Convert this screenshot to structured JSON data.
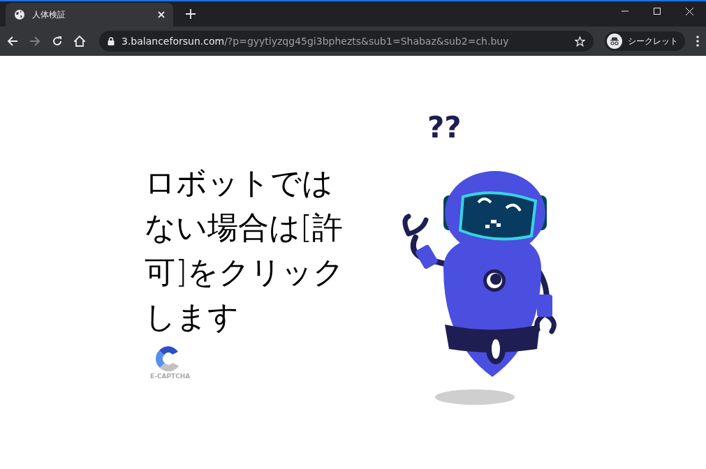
{
  "browser": {
    "tab": {
      "title": "人体検証",
      "selected": true
    },
    "address": {
      "host": "3.balanceforsun.com",
      "path": "/?p=gyytiyzqg45gi3bphezts&sub1=Shabaz&sub2=ch.buy"
    },
    "profile": "シークレット"
  },
  "page": {
    "message": "ロボットではない場合は[許可]をクリックします",
    "logo_text": "E-CAPTCHA",
    "robot_marks": "??"
  }
}
